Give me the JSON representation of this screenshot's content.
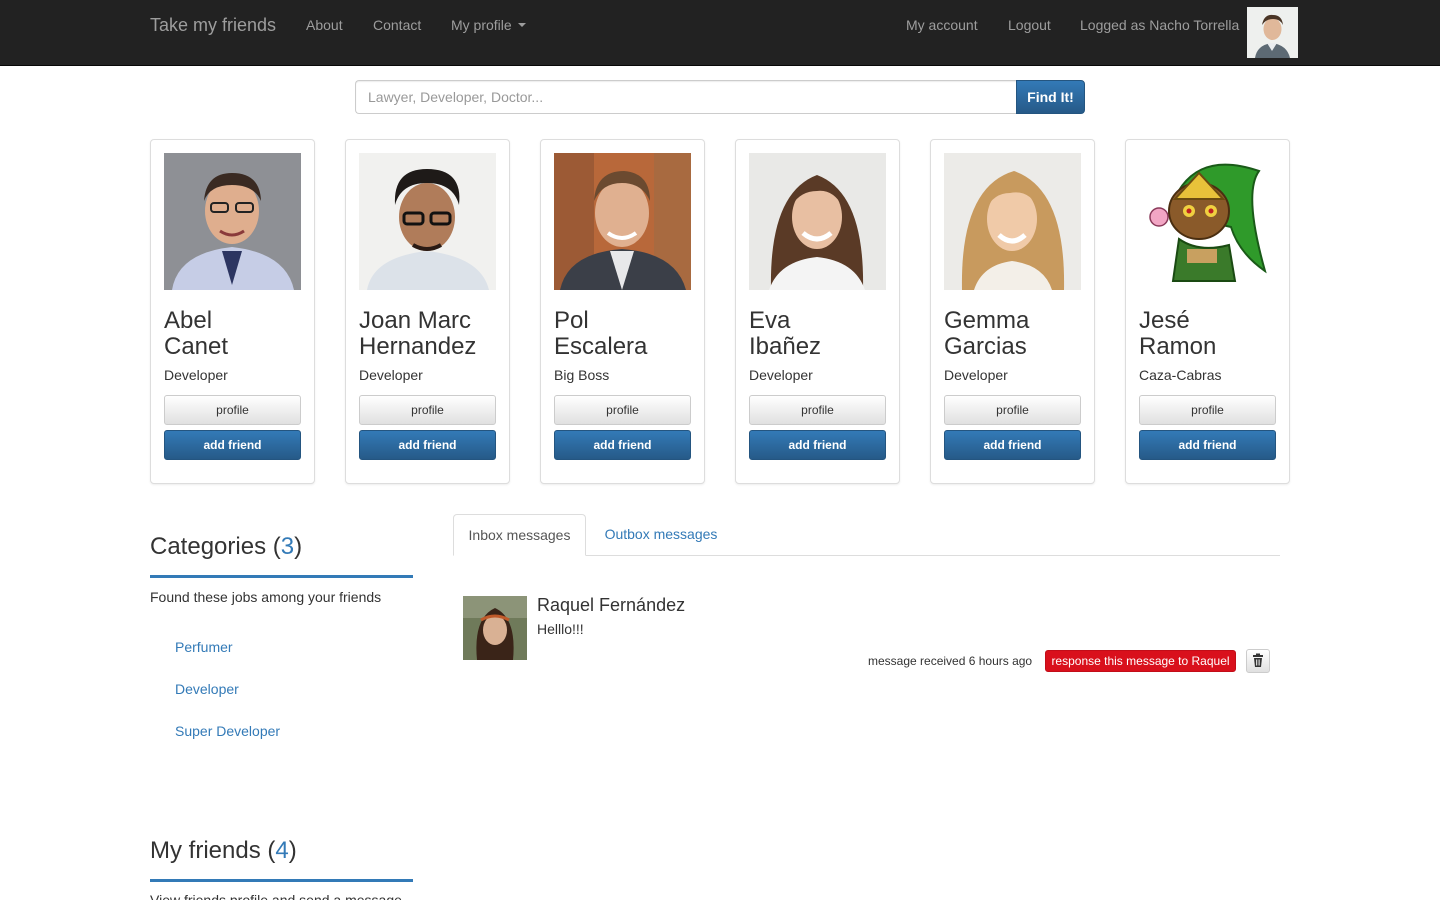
{
  "navbar": {
    "brand": "Take my friends",
    "links": {
      "about": "About",
      "contact": "Contact",
      "my_profile": "My profile",
      "my_account": "My account",
      "logout": "Logout"
    },
    "logged_as": "Logged as Nacho Torrella"
  },
  "search": {
    "placeholder": "Lawyer, Developer, Doctor...",
    "value": "",
    "button_label": "Find It!"
  },
  "cards": [
    {
      "first": "Abel",
      "last": "Canet",
      "job": "Developer",
      "profile_label": "profile",
      "add_label": "add friend"
    },
    {
      "first": "Joan Marc",
      "last": "Hernandez",
      "job": "Developer",
      "profile_label": "profile",
      "add_label": "add friend"
    },
    {
      "first": "Pol",
      "last": "Escalera",
      "job": "Big Boss",
      "profile_label": "profile",
      "add_label": "add friend"
    },
    {
      "first": "Eva",
      "last": "Ibañez",
      "job": "Developer",
      "profile_label": "profile",
      "add_label": "add friend"
    },
    {
      "first": "Gemma",
      "last": "Garcias",
      "job": "Developer",
      "profile_label": "profile",
      "add_label": "add friend"
    },
    {
      "first": "Jesé",
      "last": "Ramon",
      "job": "Caza-Cabras",
      "profile_label": "profile",
      "add_label": "add friend"
    }
  ],
  "categories": {
    "title": "Categories",
    "count": "3",
    "description": "Found these jobs among your friends",
    "items": [
      "Perfumer",
      "Developer",
      "Super Developer"
    ]
  },
  "friends": {
    "title": "My friends",
    "count": "4",
    "description": "View friends profile and send a message"
  },
  "tabs": {
    "inbox": "Inbox messages",
    "outbox": "Outbox messages"
  },
  "message": {
    "sender": "Raquel Fernández",
    "text": "Helllo!!!",
    "time": "message received 6 hours ago",
    "reply_label": "response this message to Raquel",
    "trash_icon": "trash-icon"
  },
  "colors": {
    "navbar_bg": "#222222",
    "primary": "#337ab7",
    "danger": "#d9101c"
  }
}
